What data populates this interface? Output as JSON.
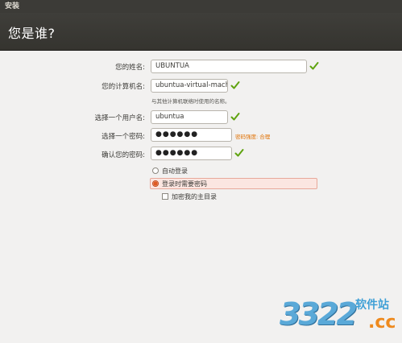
{
  "window": {
    "title": "安装"
  },
  "page": {
    "heading": "您是谁?"
  },
  "form": {
    "name": {
      "label": "您的姓名:",
      "value": "UBUNTUA"
    },
    "computer": {
      "label": "您的计算机名:",
      "value": "ubuntua-virtual-mach",
      "hint": "与其他计算机联络时使用的名称。"
    },
    "username": {
      "label": "选择一个用户名:",
      "value": "ubuntua"
    },
    "password": {
      "label": "选择一个密码:",
      "value": "●●●●●●",
      "strength": "密码强度: 合理"
    },
    "confirm": {
      "label": "确认您的密码:",
      "value": "●●●●●●"
    }
  },
  "login": {
    "auto_label": "自动登录",
    "require_label": "登录时需要密码",
    "encrypt_label": "加密我的主目录",
    "selected": "require_password",
    "encrypt_checked": false
  },
  "watermark": {
    "number": "3322",
    "site": "软件站",
    "domain": ".cc"
  },
  "colors": {
    "titlebar": "#3c3b37",
    "accent_check": "#5fa30f",
    "strength": "#e07000",
    "selection": "#fbe6e1"
  }
}
